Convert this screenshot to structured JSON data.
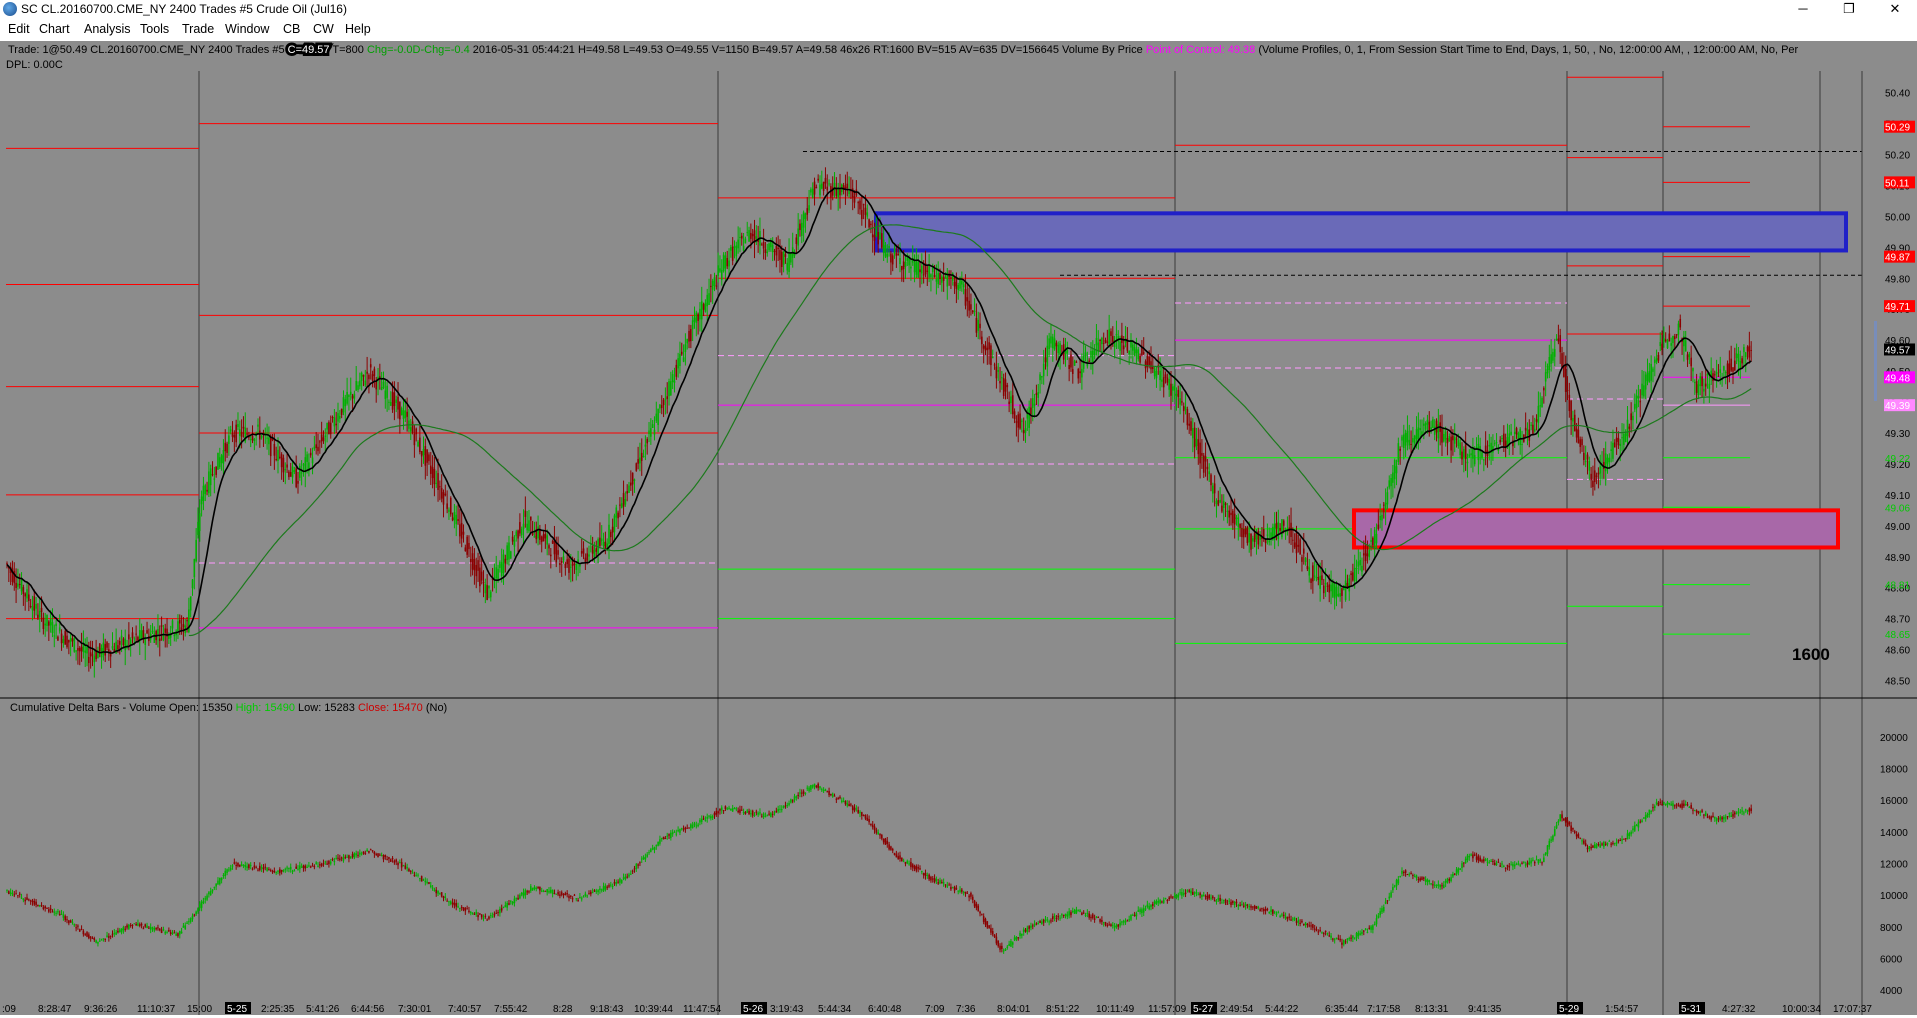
{
  "window": {
    "title": "SC CL.20160700.CME_NY  2400 Trades  #5  Crude Oil (Jul16)",
    "controls": {
      "minimize": "─",
      "restore": "❐",
      "close": "✕"
    }
  },
  "menu": [
    "Edit",
    "Chart",
    "Analysis",
    "Tools",
    "Trade",
    "Window",
    "CB",
    "CW",
    "Help"
  ],
  "header": {
    "prefix": "Trade: 1@50.49  CL.20160700.CME_NY  2400 Trades  #5 ",
    "c_badge": "C=49.57",
    "t_value": " T=800 ",
    "chg_badge": "Chg=-0.0",
    "dchg_badge": "D-Chg=-0.4",
    "details": " 2016-05-31  05:44:21  H=49.58  L=49.53  O=49.55  V=1150  B=49.57  A=49.58  46x26  RT:1600  BV=515  AV=635  DV=156645  Volume By Price  ",
    "poc": "Point of Control: 49.38",
    "profile": "  (Volume Profiles, 0, 1, From Session Start Time to End, Days, 1, 50, , No, 12:00:00 AM, , 12:00:00 AM, No, Per",
    "dpl": "DPL: 0.00C"
  },
  "lower_pane": {
    "title": "Cumulative Delta Bars - Volume  Open: 15350  ",
    "high": "High: 15490",
    "low": "  Low: 15283  ",
    "close": "Close: 15470",
    "suffix": "  (No)"
  },
  "annotation": "1600",
  "colors": {
    "bg": "#8c8c8c",
    "up": "#00b000",
    "down": "#8b0000",
    "red_line": "#ff0000",
    "green_line": "#00ff00",
    "magenta": "#ff00ff",
    "pink": "#ff99ff",
    "blue_zone": "#2020c8",
    "red_zone": "#ff0000"
  },
  "price_axis": {
    "labels": [
      "50.40",
      "50.30",
      "50.20",
      "50.10",
      "50.00",
      "49.90",
      "49.80",
      "49.70",
      "49.60",
      "49.50",
      "49.40",
      "49.30",
      "49.20",
      "49.10",
      "49.00",
      "48.90",
      "48.80",
      "48.70",
      "48.60",
      "48.50"
    ],
    "badges": [
      {
        "text": "50.29",
        "color": "#ff0000",
        "fg": "#ffffff"
      },
      {
        "text": "50.11",
        "color": "#ff0000",
        "fg": "#ffffff"
      },
      {
        "text": "49.87",
        "color": "#ff0000",
        "fg": "#ffffff"
      },
      {
        "text": "49.71",
        "color": "#ff0000",
        "fg": "#ffffff"
      },
      {
        "text": "49.57",
        "color": "#000000",
        "fg": "#ffffff"
      },
      {
        "text": "49.48",
        "color": "#ff00ff",
        "fg": "#ffffff"
      },
      {
        "text": "49.39",
        "color": "#ff88ff",
        "fg": "#ffffff"
      },
      {
        "text": "49.22",
        "color": "#00cc00",
        "fg": "#00cc00"
      },
      {
        "text": "49.06",
        "color": "#00cc00",
        "fg": "#00cc00"
      },
      {
        "text": "48.81",
        "color": "#00cc00",
        "fg": "#00cc00"
      },
      {
        "text": "48.65",
        "color": "#00cc00",
        "fg": "#00cc00"
      }
    ]
  },
  "delta_axis": {
    "labels": [
      "20000",
      "18000",
      "16000",
      "14000",
      "12000",
      "10000",
      "8000",
      "6000",
      "4000"
    ]
  },
  "time_axis": {
    "labels": [
      ":09",
      "8:28:47",
      "9:36:26",
      "11:10:37",
      "15:00",
      "5-25",
      "2:25:35",
      "5:41:26",
      "6:44:56",
      "7:30:01",
      "7:40:57",
      "7:55:42",
      "8:28",
      "9:18:43",
      "10:39:44",
      "11:47:54",
      "5-26",
      "3:19:43",
      "5:44:34",
      "6:40:48",
      "7:09",
      "7:36",
      "8:04:01",
      "8:51:22",
      "10:11:49",
      "11:57:09",
      "5-27",
      "2:49:54",
      "5:44:22",
      "6:35:44",
      "7:17:58",
      "8:13:31",
      "9:41:35",
      "5-29",
      "1:54:57",
      "5-31",
      "4:27:32",
      "10:00:34",
      "17:07:37"
    ],
    "highlighted": [
      "5-25",
      "5-26",
      "5-27",
      "5-29",
      "5-31"
    ]
  },
  "chart_data": {
    "type": "candlestick",
    "price_range": [
      48.45,
      50.47
    ],
    "delta_range": [
      3000,
      21000
    ],
    "price_path": [
      {
        "i": 0,
        "p": 48.88
      },
      {
        "i": 20,
        "p": 48.7
      },
      {
        "i": 45,
        "p": 48.58
      },
      {
        "i": 80,
        "p": 48.65
      },
      {
        "i": 100,
        "p": 48.68
      },
      {
        "i": 108,
        "p": 49.1
      },
      {
        "i": 125,
        "p": 49.3
      },
      {
        "i": 140,
        "p": 49.3
      },
      {
        "i": 160,
        "p": 49.15
      },
      {
        "i": 185,
        "p": 49.38
      },
      {
        "i": 200,
        "p": 49.5
      },
      {
        "i": 220,
        "p": 49.35
      },
      {
        "i": 245,
        "p": 49.05
      },
      {
        "i": 265,
        "p": 48.78
      },
      {
        "i": 285,
        "p": 49.02
      },
      {
        "i": 310,
        "p": 48.87
      },
      {
        "i": 330,
        "p": 48.95
      },
      {
        "i": 355,
        "p": 49.3
      },
      {
        "i": 375,
        "p": 49.6
      },
      {
        "i": 395,
        "p": 49.85
      },
      {
        "i": 410,
        "p": 49.95
      },
      {
        "i": 430,
        "p": 49.85
      },
      {
        "i": 445,
        "p": 50.1
      },
      {
        "i": 465,
        "p": 50.08
      },
      {
        "i": 485,
        "p": 49.88
      },
      {
        "i": 505,
        "p": 49.82
      },
      {
        "i": 525,
        "p": 49.78
      },
      {
        "i": 545,
        "p": 49.5
      },
      {
        "i": 560,
        "p": 49.3
      },
      {
        "i": 575,
        "p": 49.6
      },
      {
        "i": 590,
        "p": 49.5
      },
      {
        "i": 605,
        "p": 49.62
      },
      {
        "i": 625,
        "p": 49.55
      },
      {
        "i": 645,
        "p": 49.42
      },
      {
        "i": 665,
        "p": 49.1
      },
      {
        "i": 685,
        "p": 48.95
      },
      {
        "i": 705,
        "p": 49.0
      },
      {
        "i": 720,
        "p": 48.82
      },
      {
        "i": 735,
        "p": 48.78
      },
      {
        "i": 752,
        "p": 48.95
      },
      {
        "i": 768,
        "p": 49.28
      },
      {
        "i": 785,
        "p": 49.32
      },
      {
        "i": 805,
        "p": 49.22
      },
      {
        "i": 825,
        "p": 49.28
      },
      {
        "i": 840,
        "p": 49.3
      },
      {
        "i": 853,
        "p": 49.62
      },
      {
        "i": 863,
        "p": 49.3
      },
      {
        "i": 873,
        "p": 49.15
      },
      {
        "i": 890,
        "p": 49.3
      },
      {
        "i": 908,
        "p": 49.55
      },
      {
        "i": 920,
        "p": 49.65
      },
      {
        "i": 930,
        "p": 49.45
      },
      {
        "i": 945,
        "p": 49.5
      },
      {
        "i": 960,
        "p": 49.57
      }
    ],
    "delta_path": [
      {
        "i": 0,
        "v": 10300
      },
      {
        "i": 30,
        "v": 8800
      },
      {
        "i": 50,
        "v": 7000
      },
      {
        "i": 70,
        "v": 8200
      },
      {
        "i": 95,
        "v": 7500
      },
      {
        "i": 108,
        "v": 9500
      },
      {
        "i": 125,
        "v": 12000
      },
      {
        "i": 150,
        "v": 11500
      },
      {
        "i": 175,
        "v": 12000
      },
      {
        "i": 200,
        "v": 12800
      },
      {
        "i": 220,
        "v": 11800
      },
      {
        "i": 245,
        "v": 9500
      },
      {
        "i": 265,
        "v": 8500
      },
      {
        "i": 290,
        "v": 10500
      },
      {
        "i": 315,
        "v": 9800
      },
      {
        "i": 340,
        "v": 11000
      },
      {
        "i": 360,
        "v": 13500
      },
      {
        "i": 380,
        "v": 14500
      },
      {
        "i": 395,
        "v": 15500
      },
      {
        "i": 420,
        "v": 15000
      },
      {
        "i": 445,
        "v": 17000
      },
      {
        "i": 470,
        "v": 15200
      },
      {
        "i": 490,
        "v": 12500
      },
      {
        "i": 510,
        "v": 11000
      },
      {
        "i": 530,
        "v": 10000
      },
      {
        "i": 548,
        "v": 6500
      },
      {
        "i": 565,
        "v": 8200
      },
      {
        "i": 590,
        "v": 9000
      },
      {
        "i": 610,
        "v": 8000
      },
      {
        "i": 630,
        "v": 9400
      },
      {
        "i": 650,
        "v": 10200
      },
      {
        "i": 670,
        "v": 9600
      },
      {
        "i": 695,
        "v": 9000
      },
      {
        "i": 715,
        "v": 8200
      },
      {
        "i": 735,
        "v": 7000
      },
      {
        "i": 752,
        "v": 8000
      },
      {
        "i": 768,
        "v": 11500
      },
      {
        "i": 790,
        "v": 10500
      },
      {
        "i": 805,
        "v": 12500
      },
      {
        "i": 825,
        "v": 11800
      },
      {
        "i": 845,
        "v": 12200
      },
      {
        "i": 855,
        "v": 15000
      },
      {
        "i": 870,
        "v": 13000
      },
      {
        "i": 890,
        "v": 13500
      },
      {
        "i": 908,
        "v": 15800
      },
      {
        "i": 925,
        "v": 15600
      },
      {
        "i": 940,
        "v": 14800
      },
      {
        "i": 960,
        "v": 15400
      }
    ]
  }
}
